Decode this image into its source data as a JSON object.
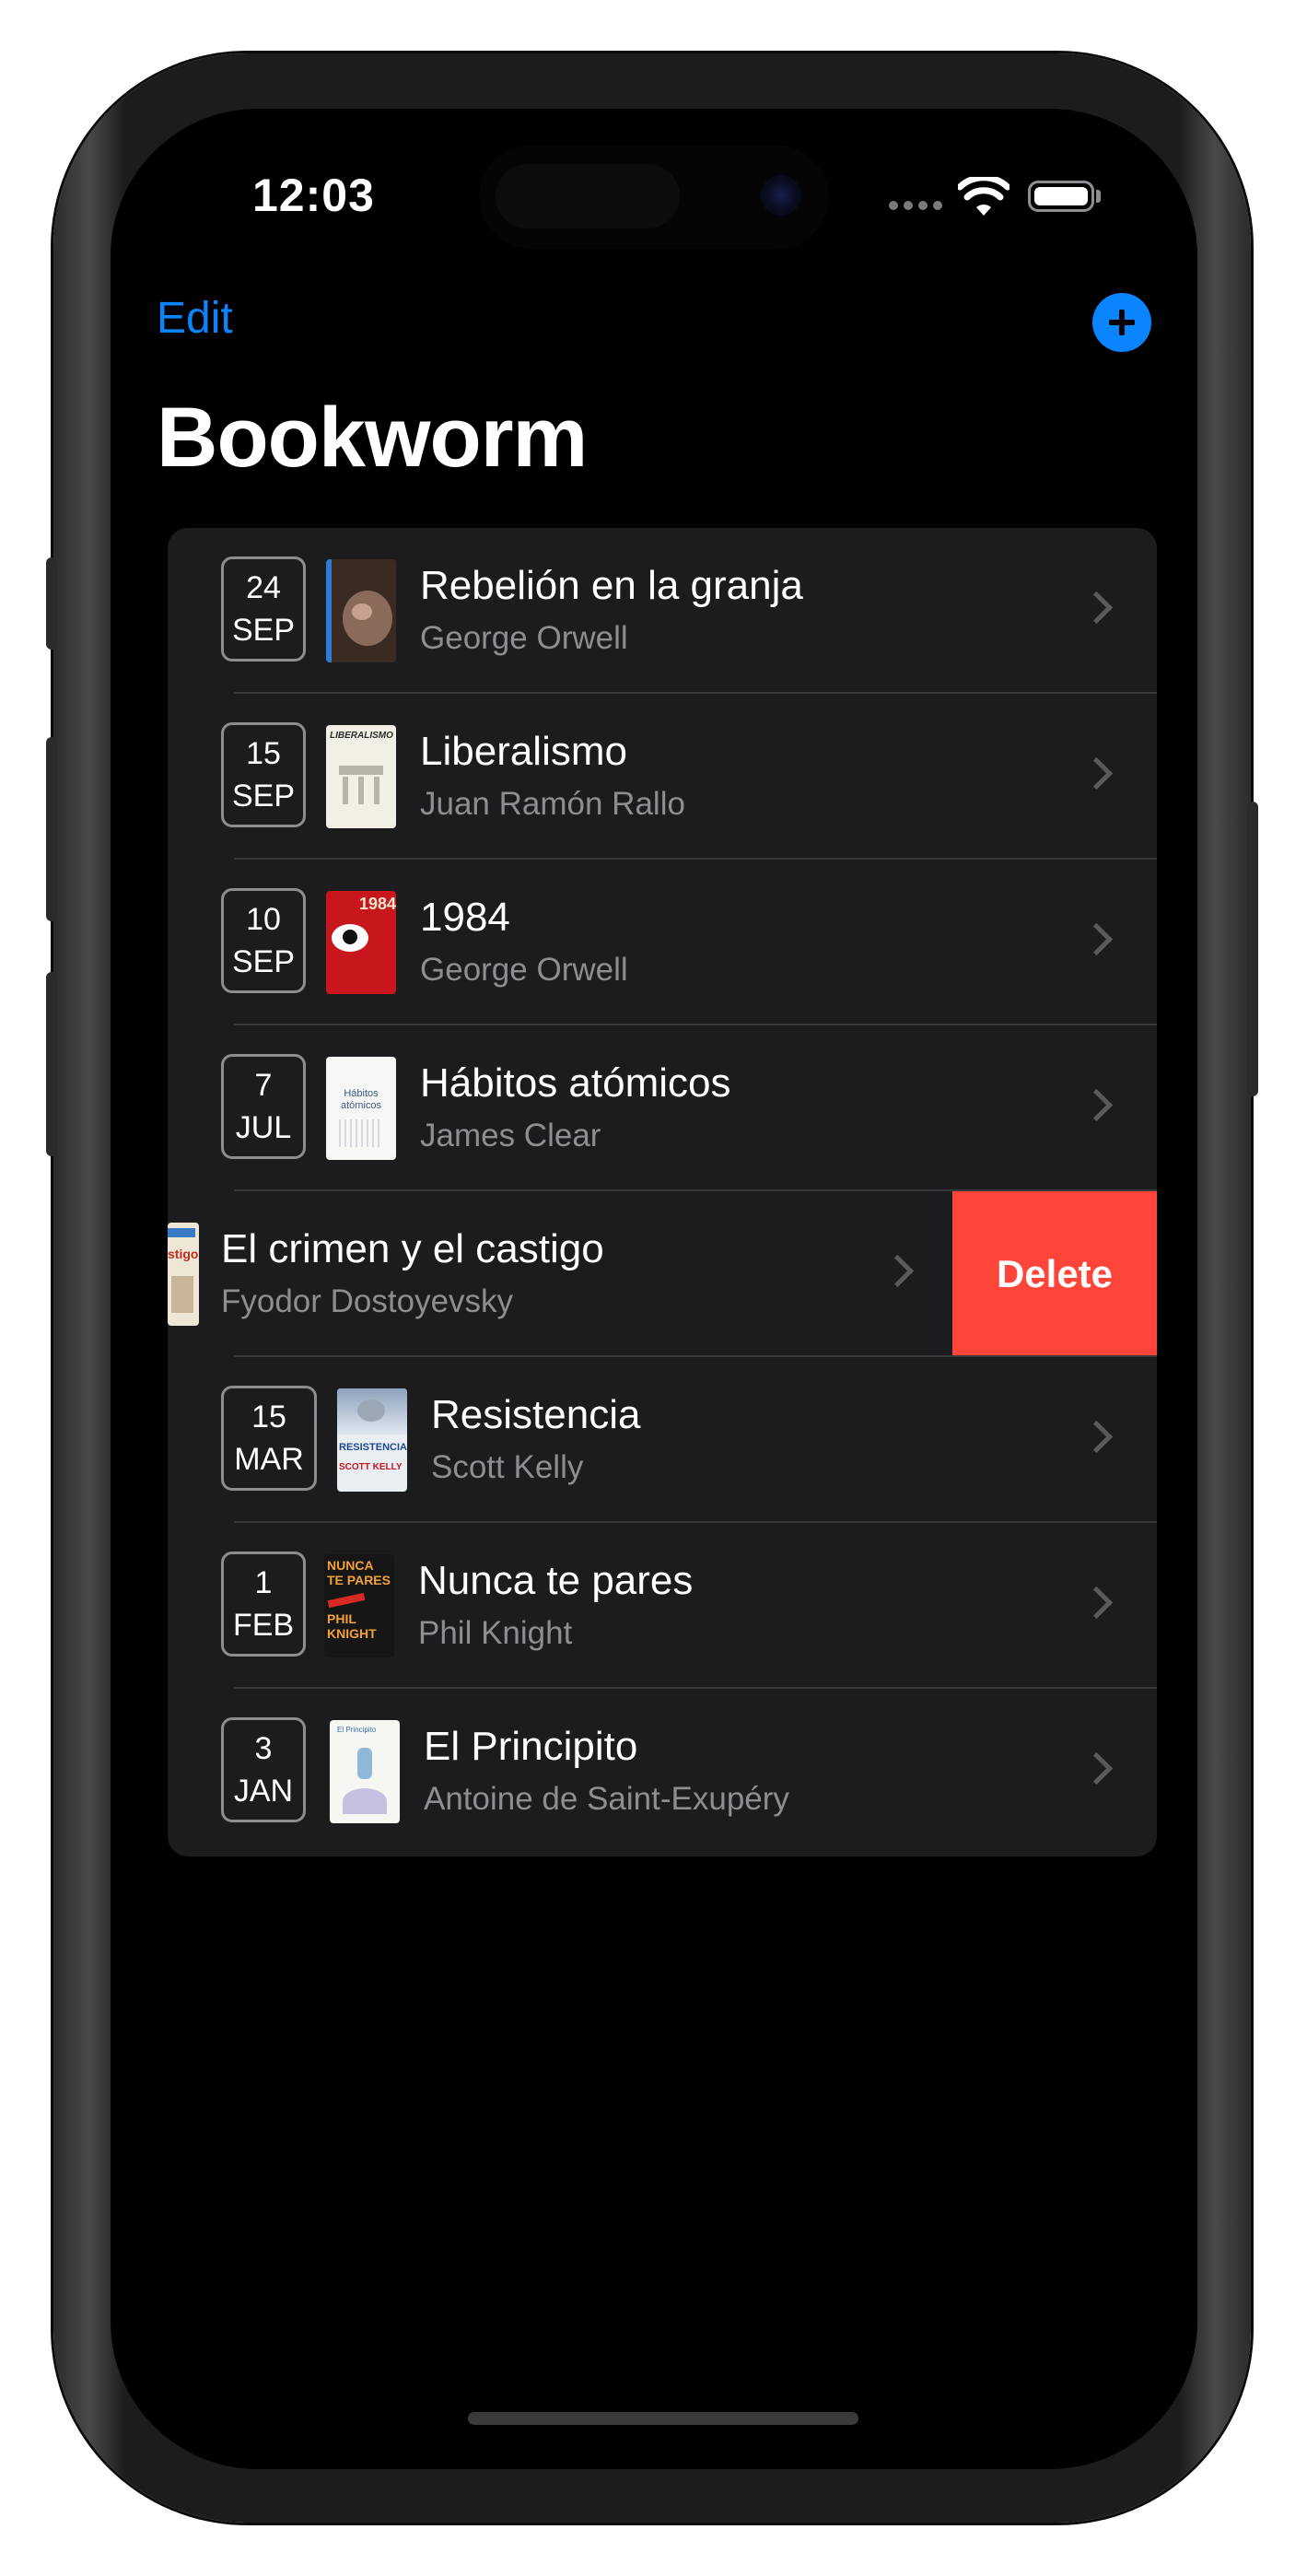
{
  "status_bar": {
    "time": "12:03"
  },
  "nav": {
    "edit_label": "Edit",
    "title": "Bookworm",
    "add_icon": "plus-circle-icon"
  },
  "colors": {
    "accent": "#0a84ff",
    "delete": "#ff453a",
    "list_bg": "#1c1c1e",
    "secondary_text": "#8d8d93"
  },
  "books": [
    {
      "day": "24",
      "month": "SEP",
      "title": "Rebelión en la granja",
      "author": "George Orwell"
    },
    {
      "day": "15",
      "month": "SEP",
      "title": "Liberalismo",
      "author": "Juan Ramón Rallo"
    },
    {
      "day": "10",
      "month": "SEP",
      "title": "1984",
      "author": "George Orwell"
    },
    {
      "day": "7",
      "month": "JUL",
      "title": "Hábitos atómicos",
      "author": "James Clear"
    },
    {
      "day": "",
      "month": "",
      "title": "El crimen y el castigo",
      "author": "Fyodor Dostoyevsky"
    },
    {
      "day": "15",
      "month": "MAR",
      "title": "Resistencia",
      "author": "Scott Kelly"
    },
    {
      "day": "1",
      "month": "FEB",
      "title": "Nunca te pares",
      "author": "Phil Knight"
    },
    {
      "day": "3",
      "month": "JAN",
      "title": "El Principito",
      "author": "Antoine de Saint-Exupéry"
    }
  ],
  "swipe_action": {
    "label": "Delete"
  },
  "covers": {
    "1984": "1984",
    "principito": "El Principito",
    "resistencia": "RESISTENCIA",
    "resistencia_author": "SCOTT KELLY",
    "nunca": "NUNCA TE PARES",
    "nunca_author": "PHIL KNIGHT",
    "liberalismo": "LIBERALISMO",
    "habitos": "Hábitos atómicos",
    "crimen": "stigo"
  }
}
